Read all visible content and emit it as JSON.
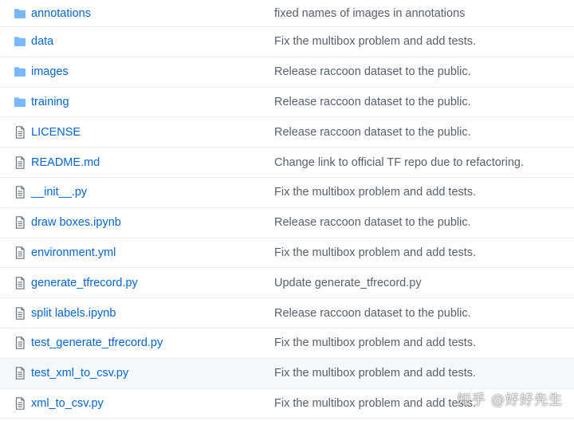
{
  "files": [
    {
      "type": "folder",
      "icon": "folder-icon",
      "name": "annotations",
      "message": "fixed names of images in annotations"
    },
    {
      "type": "folder",
      "icon": "folder-icon",
      "name": "data",
      "message": "Fix the multibox problem and add tests."
    },
    {
      "type": "folder",
      "icon": "folder-icon",
      "name": "images",
      "message": "Release raccoon dataset to the public."
    },
    {
      "type": "folder",
      "icon": "folder-icon",
      "name": "training",
      "message": "Release raccoon dataset to the public."
    },
    {
      "type": "file",
      "icon": "file-icon",
      "name": "LICENSE",
      "message": "Release raccoon dataset to the public."
    },
    {
      "type": "file",
      "icon": "file-icon",
      "name": "README.md",
      "message": "Change link to official TF repo due to refactoring."
    },
    {
      "type": "file",
      "icon": "file-icon",
      "name": "__init__.py",
      "message": "Fix the multibox problem and add tests."
    },
    {
      "type": "file",
      "icon": "file-icon",
      "name": "draw boxes.ipynb",
      "message": "Release raccoon dataset to the public."
    },
    {
      "type": "file",
      "icon": "file-icon",
      "name": "environment.yml",
      "message": "Fix the multibox problem and add tests."
    },
    {
      "type": "file",
      "icon": "file-icon",
      "name": "generate_tfrecord.py",
      "message": "Update generate_tfrecord.py"
    },
    {
      "type": "file",
      "icon": "file-icon",
      "name": "split labels.ipynb",
      "message": "Release raccoon dataset to the public."
    },
    {
      "type": "file",
      "icon": "file-icon",
      "name": "test_generate_tfrecord.py",
      "message": "Fix the multibox problem and add tests."
    },
    {
      "type": "file",
      "icon": "file-icon",
      "name": "test_xml_to_csv.py",
      "message": "Fix the multibox problem and add tests."
    },
    {
      "type": "file",
      "icon": "file-icon",
      "name": "xml_to_csv.py",
      "message": "Fix the multibox problem and add tests."
    }
  ],
  "watermark": "知乎 @好好先生",
  "colors": {
    "link": "#0366d6",
    "folder_icon": "#79b8ff",
    "file_icon": "#6a737d",
    "message": "#586069"
  }
}
